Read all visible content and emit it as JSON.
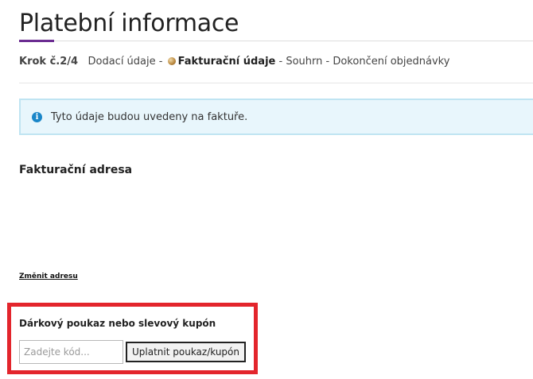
{
  "page": {
    "title": "Platební informace"
  },
  "steps": {
    "prefix": "Krok č.2/4",
    "step1": "Dodací údaje",
    "sep1": " - ",
    "current": "Fakturační údaje",
    "sep2": " - ",
    "step3": "Souhrn",
    "sep3": " - ",
    "step4": "Dokončení objednávky"
  },
  "info": {
    "icon": "info-icon",
    "glyph": "i",
    "text": "Tyto údaje budou uvedeny na faktuře."
  },
  "billing": {
    "heading": "Fakturační adresa",
    "change_link": "Změnit adresu"
  },
  "coupon": {
    "heading": "Dárkový poukaz nebo slevový kupón",
    "input_placeholder": "Zadejte kód...",
    "input_value": "",
    "button_label": "Uplatnit poukaz/kupón"
  },
  "colors": {
    "accent": "#6b2c91",
    "info_bg": "#e8f6fc",
    "info_border": "#bfe4f2",
    "info_icon": "#1a86c8",
    "highlight": "#e3252c"
  }
}
